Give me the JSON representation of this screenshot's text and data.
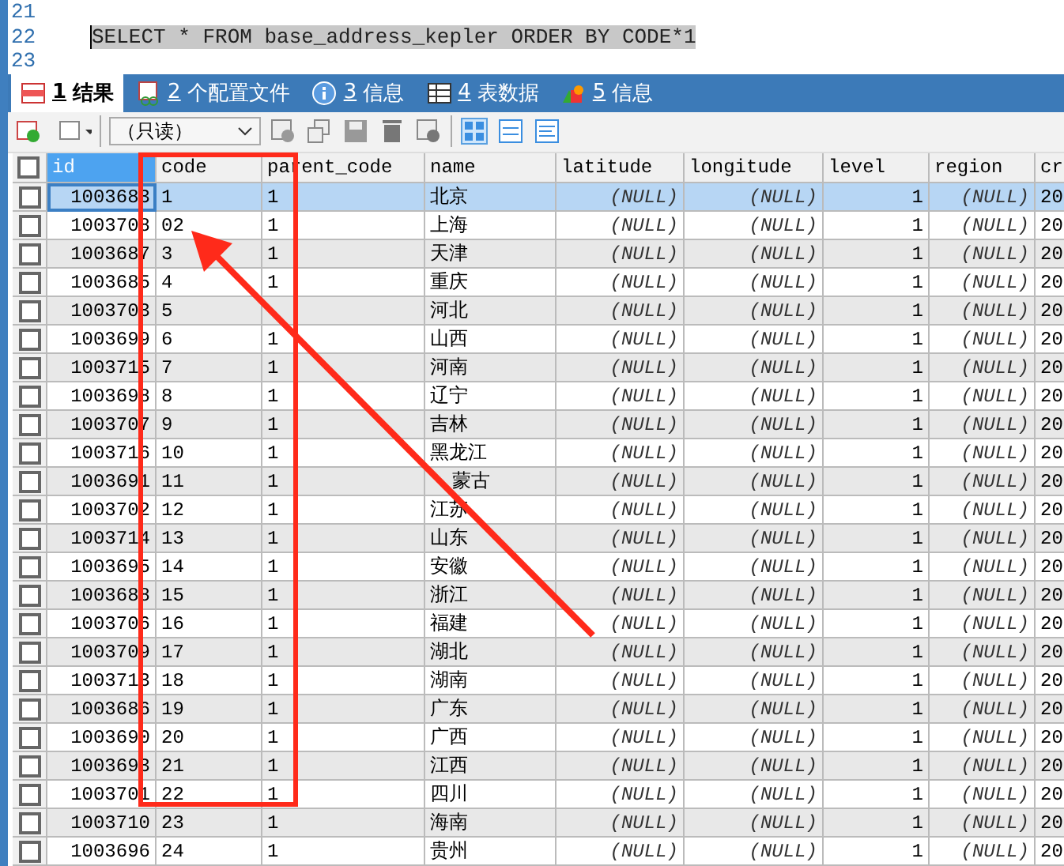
{
  "editor": {
    "lines": [
      {
        "number": "21"
      },
      {
        "number": "22",
        "code": "SELECT * FROM base_address_kepler ORDER BY CODE*1",
        "highlighted": true
      },
      {
        "number": "23"
      }
    ]
  },
  "tabs": [
    {
      "number": "1",
      "label": "结果",
      "selected": true
    },
    {
      "number": "2",
      "label": "个配置文件",
      "selected": false
    },
    {
      "number": "3",
      "label": "信息",
      "selected": false
    },
    {
      "number": "4",
      "label": "表数据",
      "selected": false
    },
    {
      "number": "5",
      "label": "信息",
      "selected": false
    }
  ],
  "toolbar": {
    "mode_select": "（只读）"
  },
  "table": {
    "all_checked": false,
    "columns": [
      {
        "label": "id",
        "kind": "number",
        "selected": true
      },
      {
        "label": "code",
        "kind": "text",
        "selected": false
      },
      {
        "label": "parent_code",
        "kind": "text",
        "selected": false
      },
      {
        "label": "name",
        "kind": "text",
        "selected": false
      },
      {
        "label": "latitude",
        "kind": "null",
        "selected": false
      },
      {
        "label": "longitude",
        "kind": "null",
        "selected": false
      },
      {
        "label": "level",
        "kind": "number",
        "selected": false
      },
      {
        "label": "region",
        "kind": "null",
        "selected": false
      },
      {
        "label": "cr",
        "kind": "text",
        "selected": false
      }
    ],
    "rows": [
      {
        "selected": true,
        "checked": false,
        "cells": [
          "1003683",
          "1",
          "1",
          "北京",
          "(NULL)",
          "(NULL)",
          "1",
          "(NULL)",
          "20"
        ]
      },
      {
        "selected": false,
        "checked": false,
        "cells": [
          "1003708",
          "02",
          "1",
          "上海",
          "(NULL)",
          "(NULL)",
          "1",
          "(NULL)",
          "20"
        ]
      },
      {
        "selected": false,
        "checked": false,
        "cells": [
          "1003687",
          "3",
          "1",
          "天津",
          "(NULL)",
          "(NULL)",
          "1",
          "(NULL)",
          "20"
        ]
      },
      {
        "selected": false,
        "checked": false,
        "cells": [
          "1003685",
          "4",
          "1",
          "重庆",
          "(NULL)",
          "(NULL)",
          "1",
          "(NULL)",
          "20"
        ]
      },
      {
        "selected": false,
        "checked": false,
        "cells": [
          "1003703",
          "5",
          "",
          "河北",
          "(NULL)",
          "(NULL)",
          "1",
          "(NULL)",
          "20"
        ]
      },
      {
        "selected": false,
        "checked": false,
        "cells": [
          "1003699",
          "6",
          "1",
          "山西",
          "(NULL)",
          "(NULL)",
          "1",
          "(NULL)",
          "20"
        ]
      },
      {
        "selected": false,
        "checked": false,
        "cells": [
          "1003715",
          "7",
          "1",
          "河南",
          "(NULL)",
          "(NULL)",
          "1",
          "(NULL)",
          "20"
        ]
      },
      {
        "selected": false,
        "checked": false,
        "cells": [
          "1003698",
          "8",
          "1",
          "辽宁",
          "(NULL)",
          "(NULL)",
          "1",
          "(NULL)",
          "20"
        ]
      },
      {
        "selected": false,
        "checked": false,
        "cells": [
          "1003707",
          "9",
          "1",
          "吉林",
          "(NULL)",
          "(NULL)",
          "1",
          "(NULL)",
          "20"
        ]
      },
      {
        "selected": false,
        "checked": false,
        "cells": [
          "1003716",
          "10",
          "1",
          "黑龙江",
          "(NULL)",
          "(NULL)",
          "1",
          "(NULL)",
          "20"
        ]
      },
      {
        "selected": false,
        "checked": false,
        "cells": [
          "1003691",
          "11",
          "1",
          "蒙古",
          "(NULL)",
          "(NULL)",
          "1",
          "(NULL)",
          "20"
        ]
      },
      {
        "selected": false,
        "checked": false,
        "cells": [
          "1003702",
          "12",
          "1",
          "江苏",
          "(NULL)",
          "(NULL)",
          "1",
          "(NULL)",
          "20"
        ]
      },
      {
        "selected": false,
        "checked": false,
        "cells": [
          "1003714",
          "13",
          "1",
          "山东",
          "(NULL)",
          "(NULL)",
          "1",
          "(NULL)",
          "20"
        ]
      },
      {
        "selected": false,
        "checked": false,
        "cells": [
          "1003695",
          "14",
          "1",
          "安徽",
          "(NULL)",
          "(NULL)",
          "1",
          "(NULL)",
          "20"
        ]
      },
      {
        "selected": false,
        "checked": false,
        "cells": [
          "1003688",
          "15",
          "1",
          "浙江",
          "(NULL)",
          "(NULL)",
          "1",
          "(NULL)",
          "20"
        ]
      },
      {
        "selected": false,
        "checked": false,
        "cells": [
          "1003706",
          "16",
          "1",
          "福建",
          "(NULL)",
          "(NULL)",
          "1",
          "(NULL)",
          "20"
        ]
      },
      {
        "selected": false,
        "checked": false,
        "cells": [
          "1003709",
          "17",
          "1",
          "湖北",
          "(NULL)",
          "(NULL)",
          "1",
          "(NULL)",
          "20"
        ]
      },
      {
        "selected": false,
        "checked": false,
        "cells": [
          "1003713",
          "18",
          "1",
          "湖南",
          "(NULL)",
          "(NULL)",
          "1",
          "(NULL)",
          "20"
        ]
      },
      {
        "selected": false,
        "checked": false,
        "cells": [
          "1003686",
          "19",
          "1",
          "广东",
          "(NULL)",
          "(NULL)",
          "1",
          "(NULL)",
          "20"
        ]
      },
      {
        "selected": false,
        "checked": false,
        "cells": [
          "1003690",
          "20",
          "1",
          "广西",
          "(NULL)",
          "(NULL)",
          "1",
          "(NULL)",
          "20"
        ]
      },
      {
        "selected": false,
        "checked": false,
        "cells": [
          "1003693",
          "21",
          "1",
          "江西",
          "(NULL)",
          "(NULL)",
          "1",
          "(NULL)",
          "20"
        ]
      },
      {
        "selected": false,
        "checked": false,
        "cells": [
          "1003701",
          "22",
          "1",
          "四川",
          "(NULL)",
          "(NULL)",
          "1",
          "(NULL)",
          "20"
        ]
      },
      {
        "selected": false,
        "checked": false,
        "cells": [
          "1003710",
          "23",
          "1",
          "海南",
          "(NULL)",
          "(NULL)",
          "1",
          "(NULL)",
          "20"
        ]
      },
      {
        "selected": false,
        "checked": false,
        "cells": [
          "1003696",
          "24",
          "1",
          "贵州",
          "(NULL)",
          "(NULL)",
          "1",
          "(NULL)",
          "20"
        ]
      }
    ]
  },
  "annotation": {
    "frame_shown": true,
    "arrow_shown": true
  }
}
